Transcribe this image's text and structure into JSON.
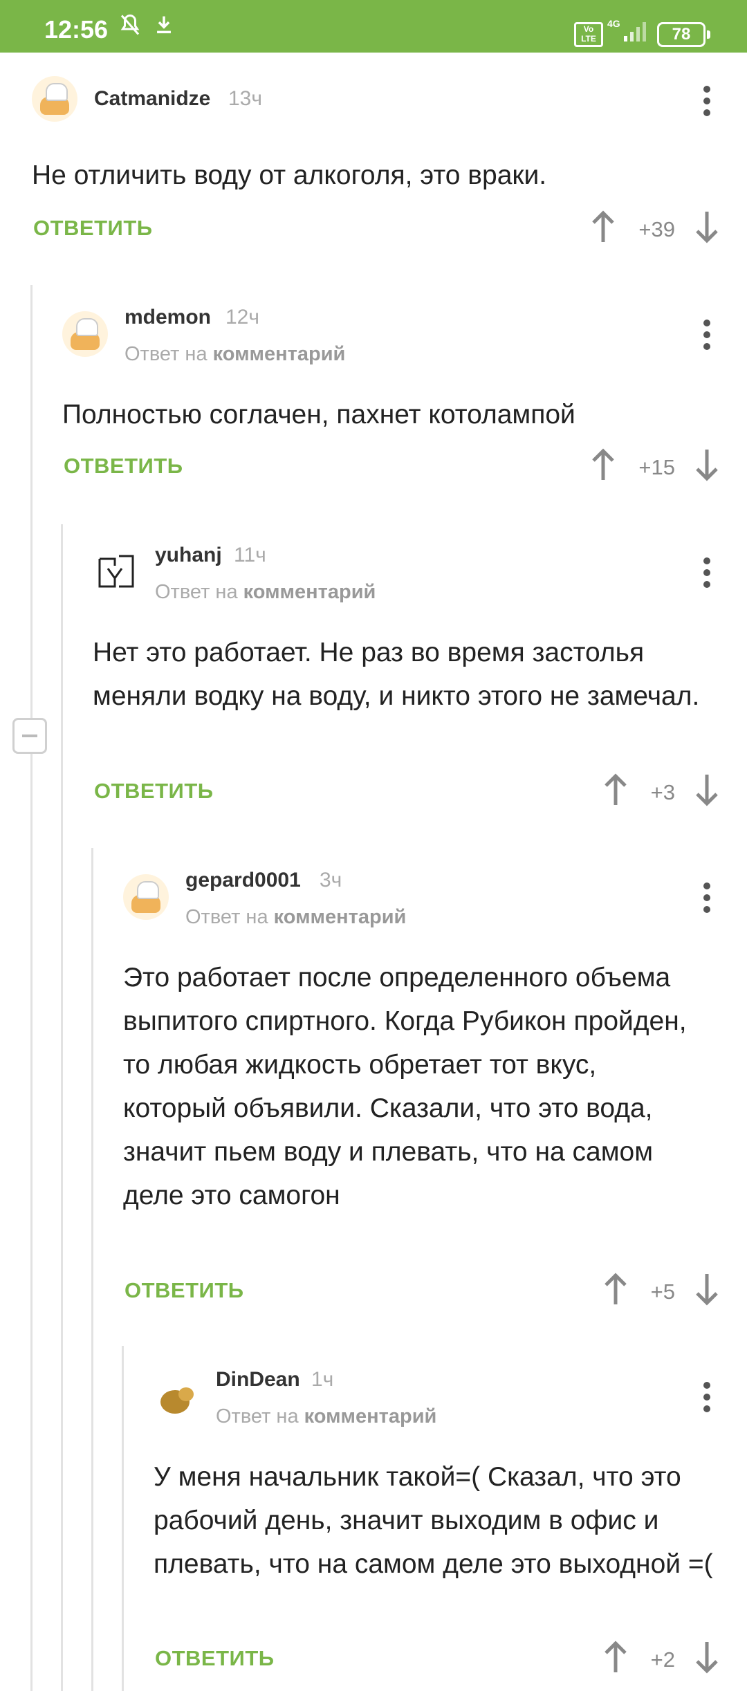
{
  "status_bar": {
    "time": "12:56",
    "volte": "Vo LTE",
    "network": "4G",
    "battery": "78"
  },
  "reply_prefix": "Ответ на",
  "reply_link": "комментарий",
  "reply_label": "ОТВЕТИТЬ",
  "comments": [
    {
      "username": "Catmanidze",
      "time": "13ч",
      "text": "Не отличить воду от алкоголя, это враки.",
      "score": "+39"
    },
    {
      "username": "mdemon",
      "time": "12ч",
      "text": "Полностью соглачен, пахнет котолампой",
      "score": "+15"
    },
    {
      "username": "yuhanj",
      "time": "11ч",
      "text": "Нет это работает. Не раз во время застолья меняли водку на воду, и никто этого не замечал.",
      "score": "+3"
    },
    {
      "username": "gepard0001",
      "time": "3ч",
      "text": "Это работает после определенного объема выпитого спиртного. Когда Рубикон пройден, то любая жидкость обретает тот вкус, который объявили. Сказали, что это вода, значит пьем воду и плевать, что на самом деле это самогон",
      "score": "+5"
    },
    {
      "username": "DinDean",
      "time": "1ч",
      "text": "У меня начальник такой=( Сказал, что это рабочий день, значит выходим в офис и плевать, что на самом деле это выходной =(",
      "score": "+2"
    }
  ]
}
